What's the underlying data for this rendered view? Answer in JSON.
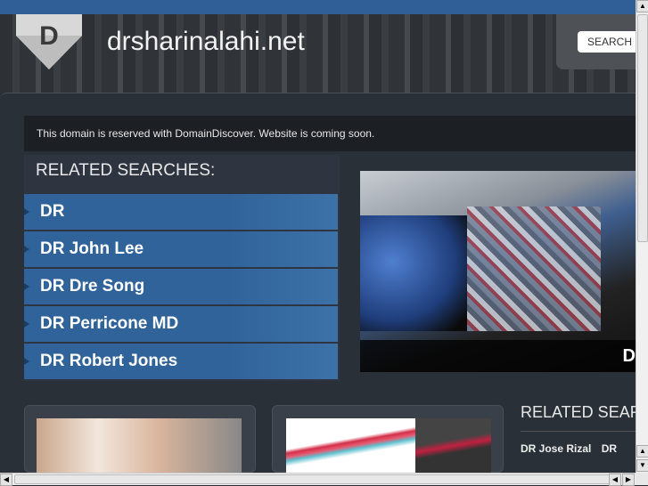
{
  "header": {
    "logo_letter": "D",
    "site_title": "drsharinalahi.net",
    "search_label": "SEARCH"
  },
  "notice": "This domain is reserved with DomainDiscover. Website is coming soon.",
  "related": {
    "title": "RELATED SEARCHES:",
    "items": [
      {
        "label": "DR"
      },
      {
        "label": "DR John Lee"
      },
      {
        "label": "DR Dre Song"
      },
      {
        "label": "DR Perricone MD"
      },
      {
        "label": "DR Robert Jones"
      }
    ]
  },
  "featured": {
    "caption": "D"
  },
  "related2": {
    "title": "RELATED SEARCHES",
    "links": [
      {
        "label": "DR Jose Rizal"
      },
      {
        "label": "DR"
      }
    ]
  },
  "scrollbars": {
    "up": "▲",
    "down": "▼",
    "left": "◀",
    "right": "▶"
  }
}
